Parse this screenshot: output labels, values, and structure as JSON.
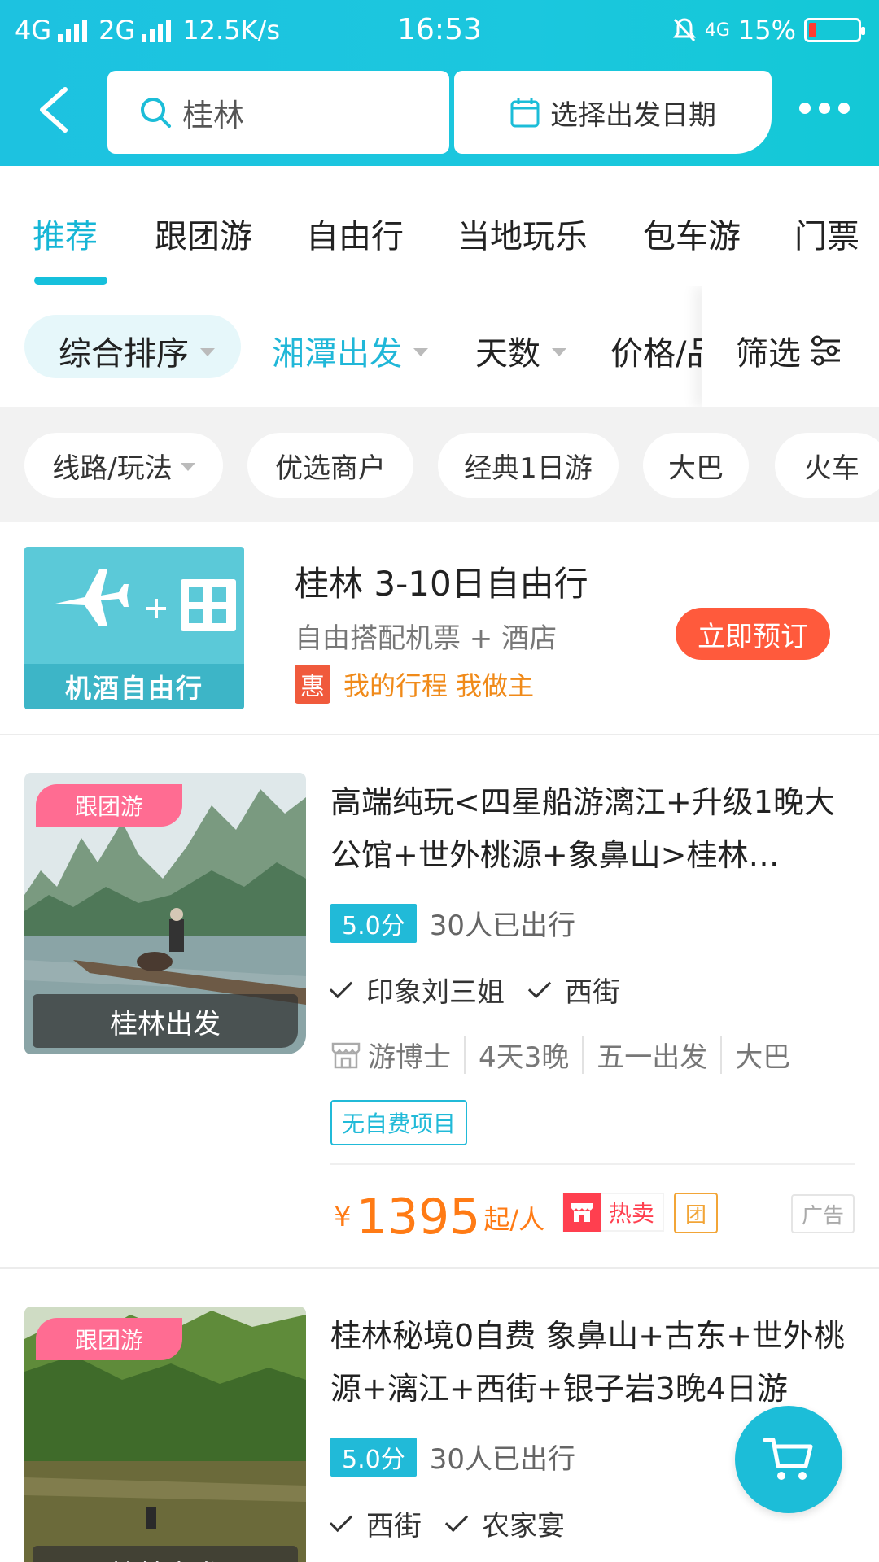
{
  "status_bar": {
    "network_left": "4G",
    "network_2g": "2G",
    "speed": "12.5K/s",
    "time": "16:53",
    "network_right": "4G",
    "battery": "15%",
    "battery_level": 0.15
  },
  "header": {
    "search_text": "桂林",
    "date_placeholder": "选择出发日期"
  },
  "tabs": [
    {
      "label": "推荐",
      "active": true
    },
    {
      "label": "跟团游"
    },
    {
      "label": "自由行"
    },
    {
      "label": "当地玩乐"
    },
    {
      "label": "包车游"
    },
    {
      "label": "门票"
    }
  ],
  "sort_bar": {
    "sort": "综合排序",
    "departure": "湘潭出发",
    "days": "天数",
    "price": "价格/品",
    "filter": "筛选"
  },
  "chips": [
    {
      "label": "线路/玩法",
      "has_dropdown": true
    },
    {
      "label": "优选商户"
    },
    {
      "label": "经典1日游"
    },
    {
      "label": "大巴"
    },
    {
      "label": "火车"
    }
  ],
  "promo": {
    "image_label": "机酒自由行",
    "title": "桂林 3-10日自由行",
    "subtitle": "自由搭配机票 + 酒店",
    "tag_icon": "惠",
    "tag_text": "我的行程 我做主",
    "button": "立即预订"
  },
  "products": [
    {
      "category": "跟团游",
      "departure": "桂林出发",
      "title": "高端纯玩<四星船游漓江+升级1晚大公馆+世外桃源+象鼻山>桂林…",
      "score": "5.0分",
      "traveled": "30人已出行",
      "features": [
        "印象刘三姐",
        "西街"
      ],
      "meta": [
        "游博士",
        "4天3晚",
        "五一出发",
        "大巴"
      ],
      "tag": "无自费项目",
      "price_symbol": "¥",
      "price": "1395",
      "price_unit": "起/人",
      "hot_label": "热卖",
      "group_label": "团",
      "ad_label": "广告"
    },
    {
      "category": "跟团游",
      "departure": "桂林出发",
      "title": "桂林秘境0自费 象鼻山+古东+世外桃源+漓江+西街+银子岩3晚4日游",
      "score": "5.0分",
      "traveled": "30人已出行",
      "features": [
        "西街",
        "农家宴"
      ]
    }
  ],
  "colors": {
    "accent": "#1dc2e0",
    "price": "#ff7b15",
    "book_button": "#ff5a3c",
    "category_pill": "#ff6c92"
  }
}
